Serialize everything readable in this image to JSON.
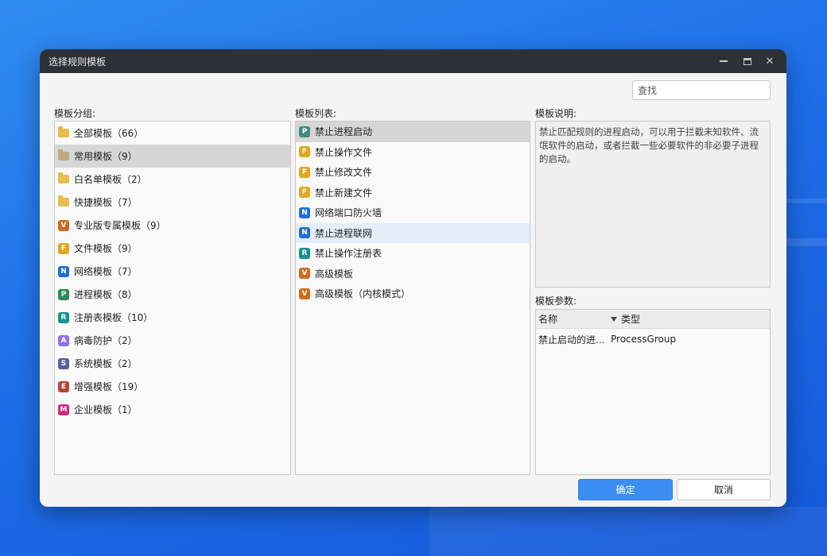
{
  "window": {
    "title": "选择规则模板"
  },
  "search": {
    "placeholder": "查找"
  },
  "groups_label": "模板分组:",
  "list_label": "模板列表:",
  "desc_label": "模板说明:",
  "params_label": "模板参数:",
  "groups": [
    {
      "icon": "folder-icon",
      "label": "全部模板（66）"
    },
    {
      "icon": "folder-icon",
      "label": "常用模板（9）"
    },
    {
      "icon": "folder-icon",
      "label": "白名单模板（2）"
    },
    {
      "icon": "folder-icon",
      "label": "快捷模板（7）"
    },
    {
      "letter": "V",
      "color": "#d2691e",
      "label": "专业版专属模板（9）"
    },
    {
      "letter": "F",
      "color": "#e0a81e",
      "label": "文件模板（9）"
    },
    {
      "letter": "N",
      "color": "#1f6fd6",
      "label": "网络模板（7）"
    },
    {
      "letter": "P",
      "color": "#2f8a55",
      "label": "进程模板（8）"
    },
    {
      "letter": "R",
      "color": "#17928c",
      "label": "注册表模板（10）"
    },
    {
      "letter": "A",
      "color": "#8f73e6",
      "label": "病毒防护（2）"
    },
    {
      "letter": "S",
      "color": "#5b5e9c",
      "label": "系统模板（2）"
    },
    {
      "letter": "E",
      "color": "#b8443c",
      "label": "增强模板（19）"
    },
    {
      "letter": "M",
      "color": "#d02a78",
      "label": "企业模板（1）"
    }
  ],
  "templates": [
    {
      "letter": "P",
      "color": "#3d8c7f",
      "label": "禁止进程启动"
    },
    {
      "letter": "F",
      "color": "#e0a81e",
      "label": "禁止操作文件"
    },
    {
      "letter": "F",
      "color": "#e0a81e",
      "label": "禁止修改文件"
    },
    {
      "letter": "F",
      "color": "#e0a81e",
      "label": "禁止新建文件"
    },
    {
      "letter": "N",
      "color": "#1f6fd6",
      "label": "网络端口防火墙"
    },
    {
      "letter": "N",
      "color": "#1f6fd6",
      "label": "禁止进程联网"
    },
    {
      "letter": "R",
      "color": "#17928c",
      "label": "禁止操作注册表"
    },
    {
      "letter": "V",
      "color": "#d2691e",
      "label": "高级模板"
    },
    {
      "letter": "V",
      "color": "#d2691e",
      "label": "高级模板（内核模式）"
    }
  ],
  "description": "禁止匹配规则的进程启动，可以用于拦截未知软件、流氓软件的启动，或者拦截一些必要软件的非必要子进程的启动。",
  "params": {
    "headers": {
      "name": "名称",
      "type": "类型"
    },
    "rows": [
      {
        "name": "禁止启动的进...",
        "type": "ProcessGroup"
      }
    ]
  },
  "buttons": {
    "ok": "确定",
    "cancel": "取消"
  }
}
